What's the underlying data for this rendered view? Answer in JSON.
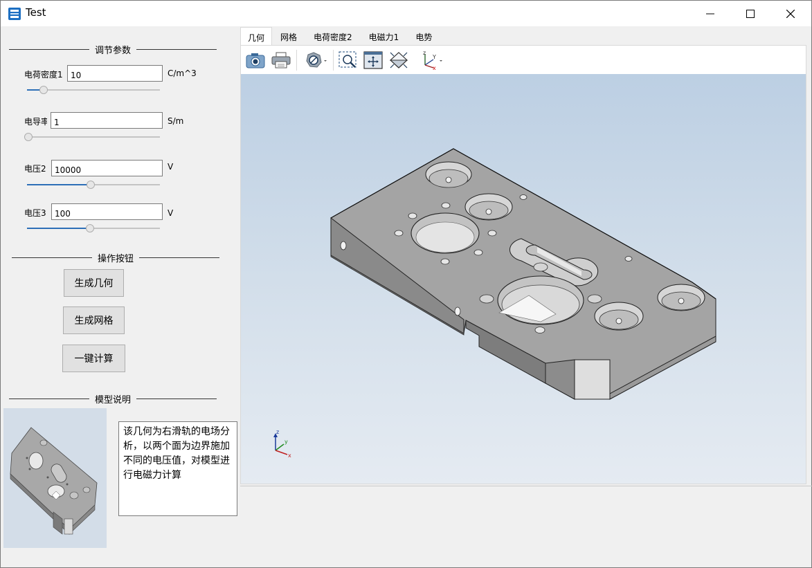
{
  "window": {
    "title": "Test"
  },
  "left_panel": {
    "params_group": {
      "title": "调节参数"
    },
    "params": [
      {
        "label": "电荷密度1",
        "value": "10",
        "unit": "C/m^3",
        "slider": 0.1
      },
      {
        "label": "电导率",
        "value": "1",
        "unit": "S/m",
        "slider": 0.0
      },
      {
        "label": "电压2",
        "value": "10000",
        "unit": "V",
        "slider": 0.48
      },
      {
        "label": "电压3",
        "value": "100",
        "unit": "V",
        "slider": 0.47
      }
    ],
    "actions_group": {
      "title": "操作按钮"
    },
    "buttons": {
      "geometry": "生成几何",
      "mesh": "生成网格",
      "compute": "一键计算"
    },
    "model_group": {
      "title": "模型说明"
    },
    "description": "该几何为右滑轨的电场分析，以两个面为边界施加不同的电压值，对模型进行电磁力计算"
  },
  "tabs": [
    {
      "label": "几何",
      "active": true
    },
    {
      "label": "网格",
      "active": false
    },
    {
      "label": "电荷密度2",
      "active": false
    },
    {
      "label": "电磁力1",
      "active": false
    },
    {
      "label": "电势",
      "active": false
    }
  ],
  "toolbar": {
    "tools": [
      "camera-icon",
      "print-icon",
      "hide-icon",
      "zoom-box-icon",
      "zoom-extents-icon",
      "isometric-view-icon",
      "axes-icon"
    ]
  },
  "triad": {
    "x": "x",
    "y": "y",
    "z": "z"
  },
  "colors": {
    "slider_fill": "#2d6fb7",
    "part_top": "#a4a4a4",
    "part_side": "#7d7d7d",
    "part_end": "#dcdcdc"
  }
}
